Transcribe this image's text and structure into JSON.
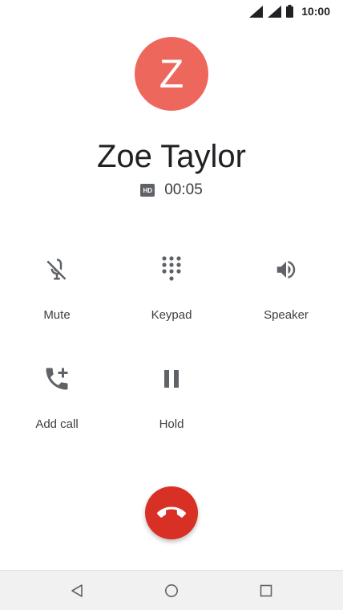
{
  "status_bar": {
    "time": "10:00"
  },
  "contact": {
    "initial": "Z",
    "name": "Zoe Taylor",
    "avatar_color": "#ee675c"
  },
  "call": {
    "hd_label": "HD",
    "duration": "00:05"
  },
  "controls": {
    "mute": {
      "label": "Mute",
      "icon": "mic-off-icon"
    },
    "keypad": {
      "label": "Keypad",
      "icon": "dialpad-icon"
    },
    "speaker": {
      "label": "Speaker",
      "icon": "volume-icon"
    },
    "add_call": {
      "label": "Add call",
      "icon": "add-call-icon"
    },
    "hold": {
      "label": "Hold",
      "icon": "pause-icon"
    }
  },
  "end_call": {
    "icon": "call-end-icon",
    "color": "#d93025"
  },
  "nav": {
    "back": "back-icon",
    "home": "home-icon",
    "recents": "recents-icon"
  }
}
